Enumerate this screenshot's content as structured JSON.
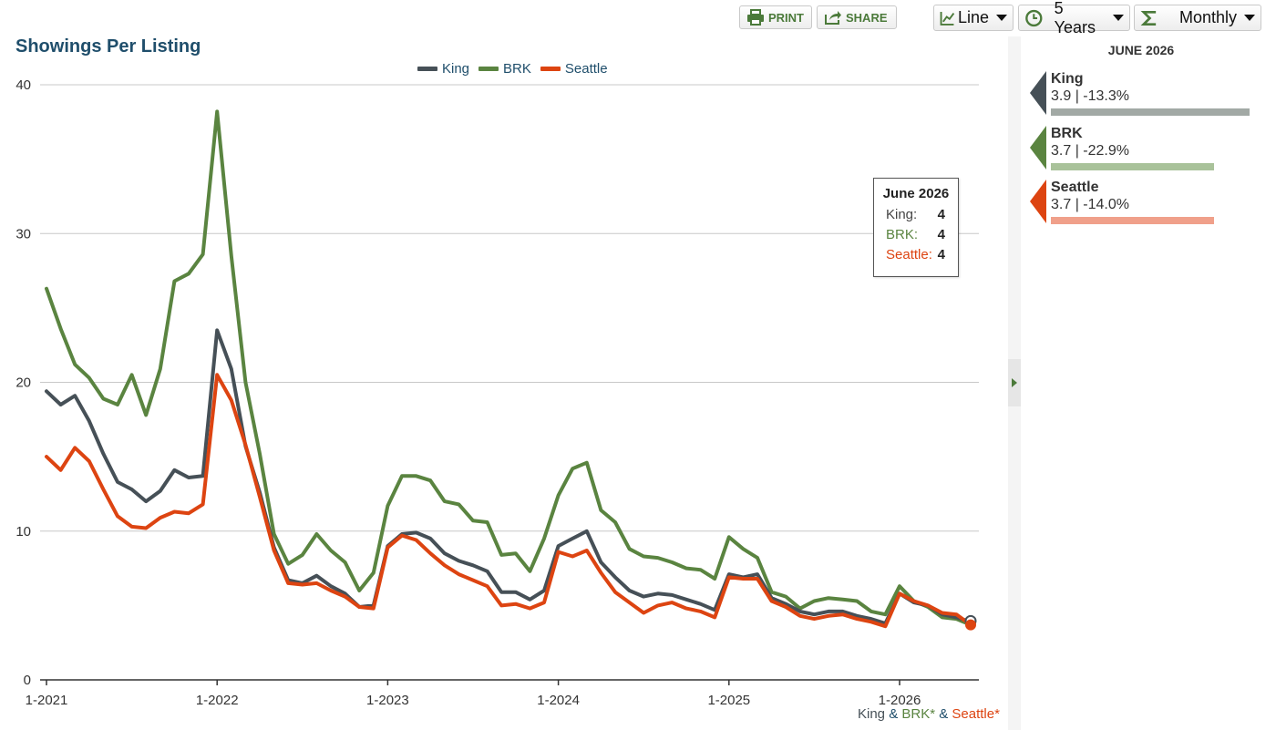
{
  "toolbar": {
    "print_label": "PRINT",
    "share_label": "SHARE",
    "chart_type_label": "Line",
    "range_label": "5 Years",
    "interval_label": "Monthly"
  },
  "colors": {
    "King": "#465057",
    "BRK": "#5a8440",
    "Seattle": "#dd4411",
    "title": "#1f4e6b"
  },
  "tooltip": {
    "title": "June 2026",
    "rows": [
      {
        "label": "King:",
        "value": "4"
      },
      {
        "label": "BRK:",
        "value": "4"
      },
      {
        "label": "Seattle:",
        "value": "4"
      }
    ]
  },
  "footnote": {
    "king": "King",
    "amp1": " & ",
    "brk": "BRK*",
    "amp2": " & ",
    "seattle": "Seattle*"
  },
  "sidebar": {
    "date": "JUNE 2026",
    "entries": [
      {
        "name": "King",
        "value": "3.9 | -13.3%",
        "bar_fraction": 1.0,
        "arrow": "#465057",
        "bar": "#a2a9a5"
      },
      {
        "name": "BRK",
        "value": "3.7 | -22.9%",
        "bar_fraction": 0.82,
        "arrow": "#5a8440",
        "bar": "#a9c29a"
      },
      {
        "name": "Seattle",
        "value": "3.7 | -14.0%",
        "bar_fraction": 0.82,
        "arrow": "#dd4411",
        "bar": "#f0a08a"
      }
    ]
  },
  "chart_data": {
    "type": "line",
    "title": "Showings Per Listing",
    "xlabel": "",
    "ylabel": "",
    "ylim": [
      0,
      40
    ],
    "yticks": [
      0,
      10,
      20,
      30,
      40
    ],
    "x_start": "2021-01",
    "x_end": "2026-06",
    "xtick_labels": [
      "1-2021",
      "1-2022",
      "1-2023",
      "1-2024",
      "1-2025",
      "1-2026"
    ],
    "legend": "top-center",
    "grid": true,
    "series": [
      {
        "name": "King",
        "values": [
          19.4,
          18.5,
          19.1,
          17.4,
          15.2,
          13.3,
          12.8,
          12.0,
          12.7,
          14.1,
          13.6,
          13.7,
          23.5,
          20.9,
          15.7,
          12.6,
          8.9,
          6.7,
          6.5,
          7.0,
          6.3,
          5.8,
          4.9,
          5.0,
          9.0,
          9.8,
          9.9,
          9.5,
          8.5,
          8.0,
          7.7,
          7.3,
          5.9,
          5.9,
          5.4,
          6.0,
          9.0,
          9.5,
          10.0,
          7.9,
          6.9,
          6.0,
          5.6,
          5.8,
          5.7,
          5.4,
          5.1,
          4.7,
          7.1,
          6.9,
          7.1,
          5.5,
          5.1,
          4.6,
          4.4,
          4.6,
          4.6,
          4.3,
          4.1,
          3.8,
          5.8,
          5.2,
          5.0,
          4.4,
          4.2,
          3.9
        ]
      },
      {
        "name": "BRK",
        "values": [
          26.3,
          23.6,
          21.2,
          20.3,
          18.9,
          18.5,
          20.5,
          17.8,
          20.9,
          26.8,
          27.3,
          28.6,
          38.2,
          28.5,
          20.0,
          15.2,
          9.8,
          7.8,
          8.4,
          9.8,
          8.7,
          7.9,
          6.0,
          7.2,
          11.7,
          13.7,
          13.7,
          13.4,
          12.0,
          11.8,
          10.7,
          10.6,
          8.4,
          8.5,
          7.3,
          9.5,
          12.4,
          14.2,
          14.6,
          11.4,
          10.6,
          8.8,
          8.3,
          8.2,
          7.9,
          7.5,
          7.4,
          6.8,
          9.6,
          8.8,
          8.2,
          5.9,
          5.6,
          4.8,
          5.3,
          5.5,
          5.4,
          5.3,
          4.6,
          4.4,
          6.3,
          5.3,
          4.9,
          4.2,
          4.1,
          3.7
        ]
      },
      {
        "name": "Seattle",
        "values": [
          15.0,
          14.1,
          15.6,
          14.7,
          12.8,
          11.0,
          10.3,
          10.2,
          10.9,
          11.3,
          11.2,
          11.8,
          20.5,
          18.8,
          15.8,
          12.3,
          8.7,
          6.5,
          6.4,
          6.5,
          6.0,
          5.6,
          4.9,
          4.8,
          8.9,
          9.7,
          9.4,
          8.5,
          7.7,
          7.1,
          6.7,
          6.3,
          5.0,
          5.1,
          4.8,
          5.2,
          8.6,
          8.3,
          8.7,
          7.2,
          5.9,
          5.2,
          4.5,
          5.0,
          5.2,
          4.8,
          4.6,
          4.2,
          6.9,
          6.8,
          6.8,
          5.3,
          4.9,
          4.3,
          4.1,
          4.3,
          4.4,
          4.1,
          3.9,
          3.6,
          5.8,
          5.3,
          5.0,
          4.5,
          4.4,
          3.7
        ]
      }
    ]
  }
}
